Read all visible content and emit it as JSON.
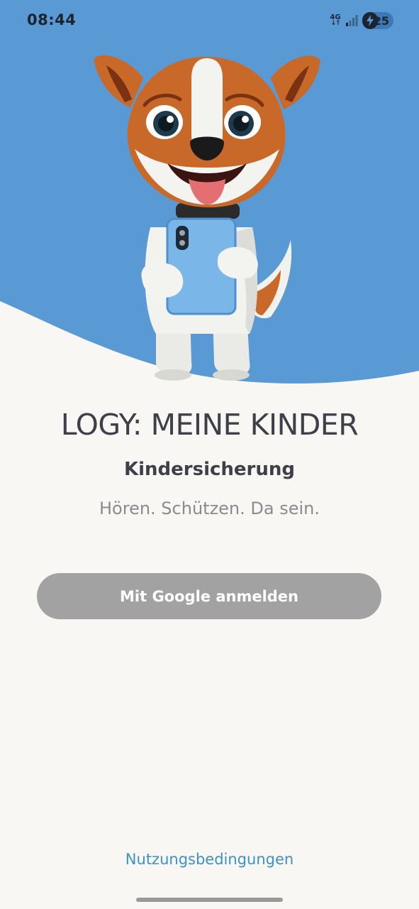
{
  "status_bar": {
    "time": "08:44",
    "network_label": "4G",
    "battery_level": "25"
  },
  "hero": {
    "background_color": "#5a9ad4",
    "mascot_icon": "dog-mascot-holding-phone-illustration"
  },
  "app": {
    "title": "LOGY: MEINE KINDER",
    "subtitle": "Kindersicherung",
    "tagline": "Hören. Schützen. Da sein."
  },
  "actions": {
    "google_sign_in_label": "Mit Google anmelden",
    "terms_link_label": "Nutzungsbedingungen"
  },
  "colors": {
    "accent_link": "#3c92c4",
    "button_bg": "#a2a2a2",
    "page_bg": "#f8f7f4"
  }
}
